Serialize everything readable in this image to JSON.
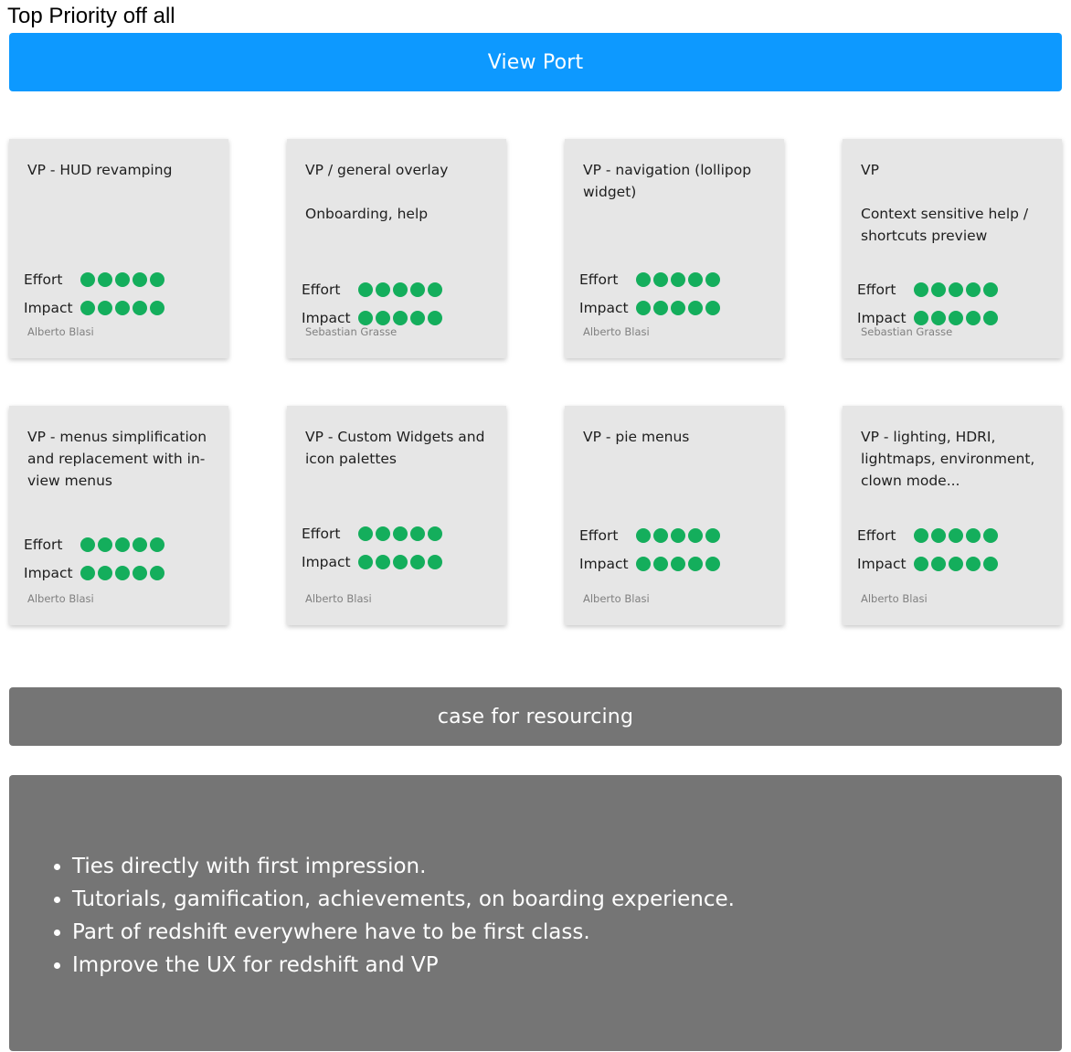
{
  "page": {
    "title": "Top Priority off all"
  },
  "viewport_section": {
    "label": "View Port",
    "color": "#0d99ff"
  },
  "rating_color": "#14ae5c",
  "cards": [
    {
      "text": "VP - HUD revamping",
      "effort_label": "Effort",
      "impact_label": "Impact",
      "effort": 5,
      "impact": 5,
      "author": "Alberto Blasi"
    },
    {
      "text": "VP / general overlay\n\nOnboarding, help",
      "effort_label": "Effort",
      "impact_label": "Impact",
      "effort": 5,
      "impact": 5,
      "author": "Sebastian Grasse"
    },
    {
      "text": "VP - navigation (lollipop widget)",
      "effort_label": "Effort",
      "impact_label": "Impact",
      "effort": 5,
      "impact": 5,
      "author": "Alberto Blasi"
    },
    {
      "text": "VP\n\nContext sensitive help / shortcuts preview",
      "effort_label": "Effort",
      "impact_label": "Impact",
      "effort": 5,
      "impact": 5,
      "author": "Sebastian Grasse"
    },
    {
      "text": "VP - menus simplification and replacement with in-view menus",
      "effort_label": "Effort",
      "impact_label": "Impact",
      "effort": 5,
      "impact": 5,
      "author": "Alberto Blasi"
    },
    {
      "text": "VP - Custom Widgets and icon palettes",
      "effort_label": "Effort",
      "impact_label": "Impact",
      "effort": 5,
      "impact": 5,
      "author": "Alberto Blasi"
    },
    {
      "text": "VP - pie menus",
      "effort_label": "Effort",
      "impact_label": "Impact",
      "effort": 5,
      "impact": 5,
      "author": "Alberto Blasi"
    },
    {
      "text": "VP - lighting, HDRI, lightmaps, environment, clown mode...",
      "effort_label": "Effort",
      "impact_label": "Impact",
      "effort": 5,
      "impact": 5,
      "author": "Alberto Blasi"
    }
  ],
  "case_section": {
    "label": "case for resourcing",
    "color": "#757575",
    "bullets": [
      "Ties directly with first impression.",
      "Tutorials, gamification, achievements, on boarding experience.",
      "Part of redshift everywhere have to be first class.",
      "Improve the UX for redshift and VP"
    ]
  }
}
